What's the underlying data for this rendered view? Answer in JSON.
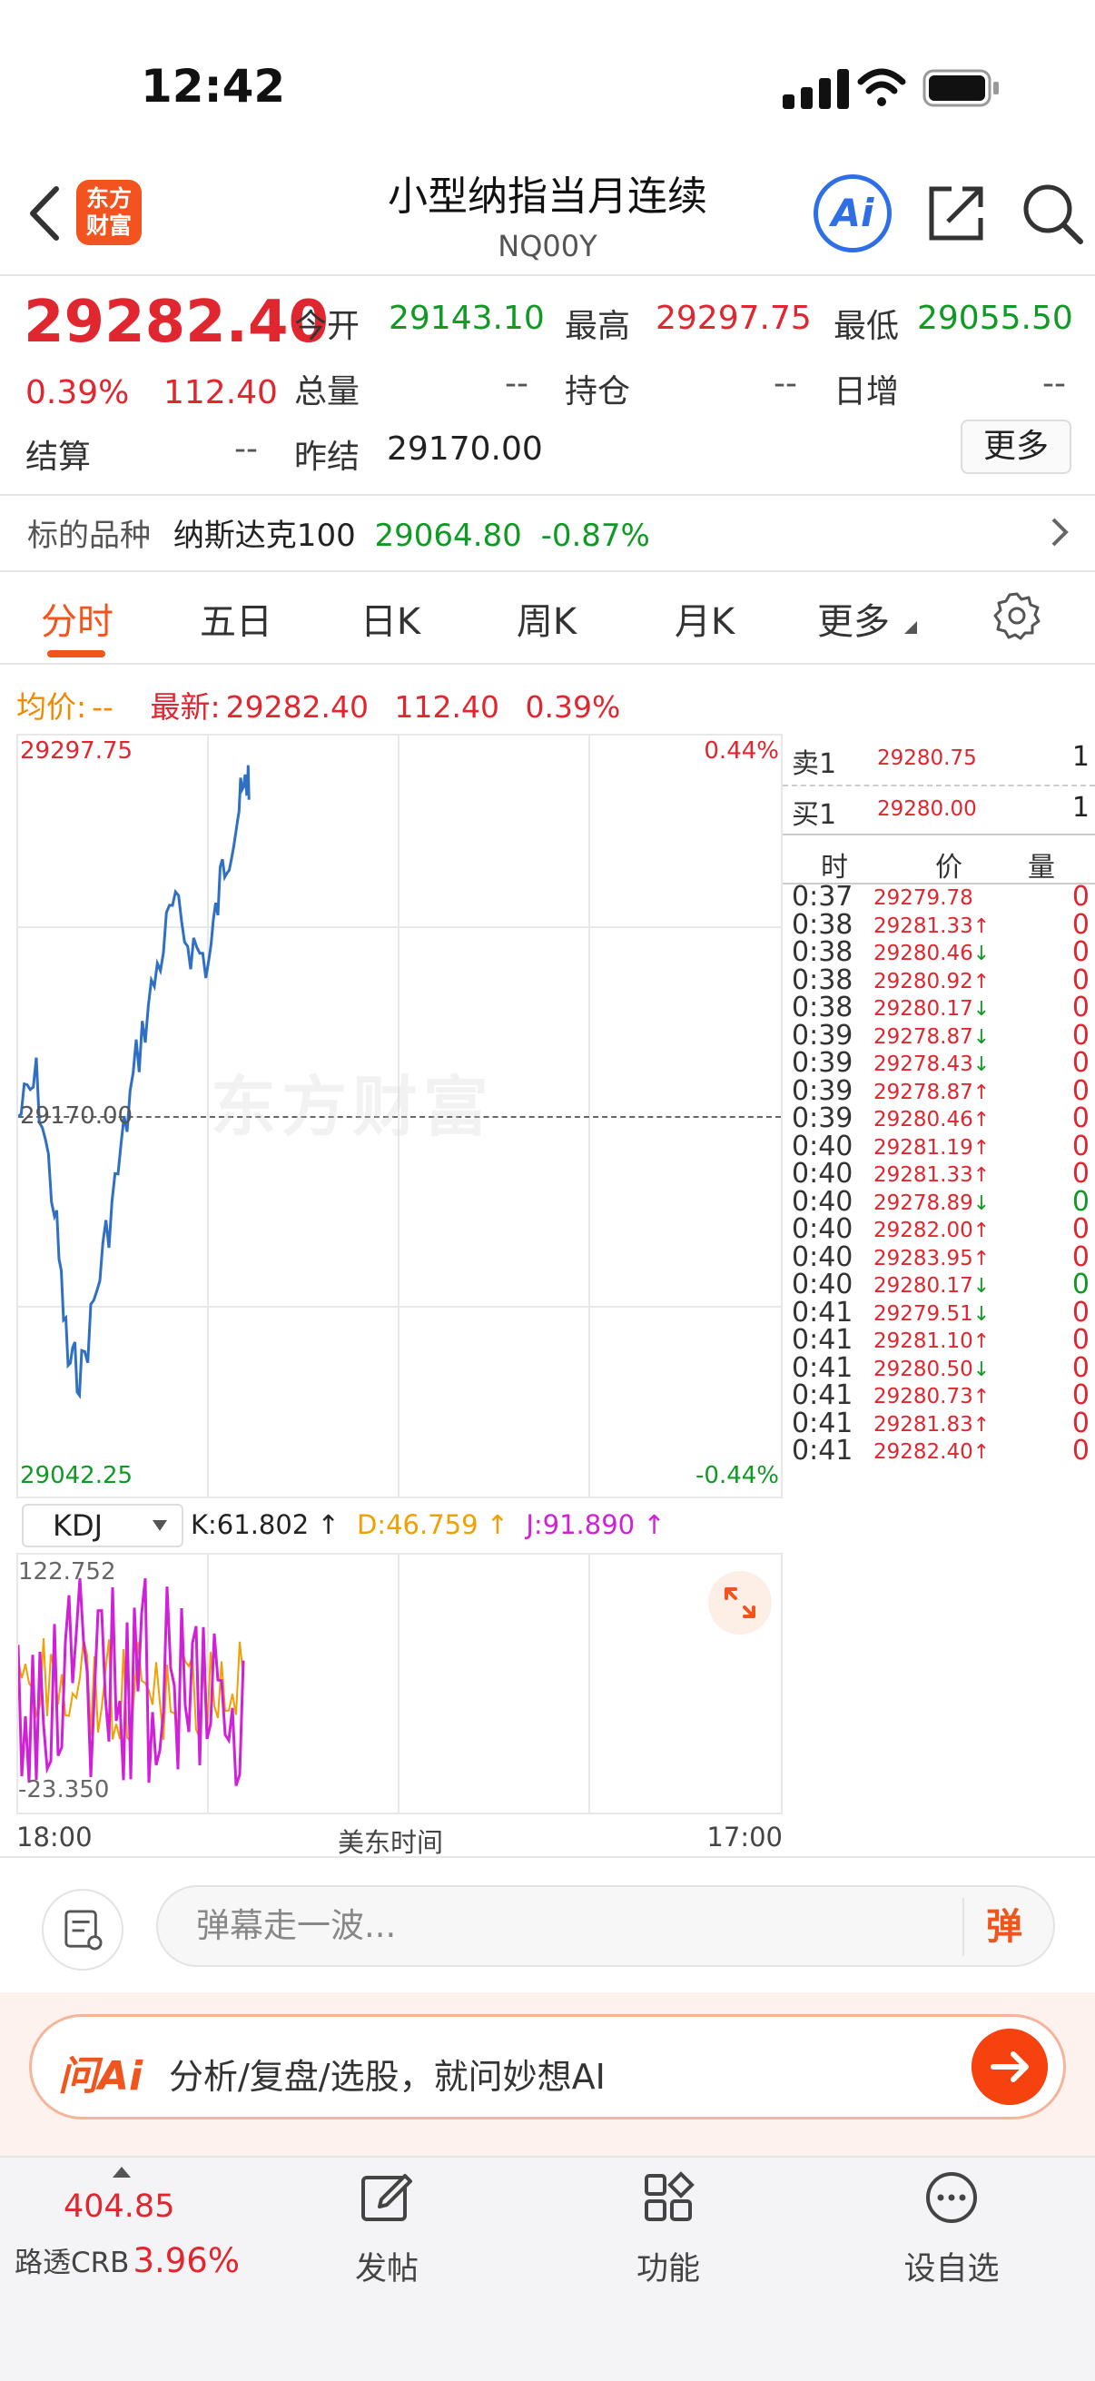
{
  "status": {
    "time": "12:42"
  },
  "header": {
    "logo_line1": "东方",
    "logo_line2": "财富",
    "title": "小型纳指当月连续",
    "code": "NQ00Y",
    "ai_label": "Ai"
  },
  "quote": {
    "price": "29282.40",
    "change_pct": "0.39%",
    "change": "112.40",
    "open_label": "今开",
    "open": "29143.10",
    "high_label": "最高",
    "high": "29297.75",
    "low_label": "最低",
    "low": "29055.50",
    "volume_label": "总量",
    "volume": "--",
    "position_label": "持仓",
    "position": "--",
    "daily_inc_label": "日增",
    "daily_inc": "--",
    "settle_label": "结算",
    "settle": "--",
    "prev_settle_label": "昨结",
    "prev_settle": "29170.00",
    "more_label": "更多"
  },
  "underlying": {
    "label": "标的品种",
    "name": "纳斯达克100",
    "price": "29064.80",
    "change": "-0.87%"
  },
  "tabs": [
    "分时",
    "五日",
    "日K",
    "周K",
    "月K",
    "更多"
  ],
  "avg_row": {
    "avg_label": "均价:",
    "avg_value": "--",
    "latest_label": "最新:",
    "latest_price": "29282.40",
    "latest_change": "112.40",
    "latest_pct": "0.39%"
  },
  "chart_labels": {
    "y_top": "29297.75",
    "y_mid": "29170.00",
    "y_bottom": "29042.25",
    "pct_top": "0.44%",
    "pct_bottom": "-0.44%",
    "watermark": "东方财富"
  },
  "kdj": {
    "indicator": "KDJ",
    "k": "K:61.802 ↑",
    "d": "D:46.759 ↑",
    "j": "J:91.890 ↑",
    "y_top": "122.752",
    "y_bottom": "-23.350",
    "time_start": "18:00",
    "time_mid": "美东时间",
    "time_end": "17:00"
  },
  "order_book": {
    "sell_label": "卖1",
    "sell_price": "29280.75",
    "sell_qty": "1",
    "buy_label": "买1",
    "buy_price": "29280.00",
    "buy_qty": "1",
    "col_time": "时",
    "col_price": "价",
    "col_qty": "量"
  },
  "ticks": [
    {
      "t": "0:37",
      "p": "29279.78",
      "d": "",
      "q": "0",
      "qc": "red"
    },
    {
      "t": "0:38",
      "p": "29281.33",
      "d": "↑",
      "q": "0",
      "qc": "red"
    },
    {
      "t": "0:38",
      "p": "29280.46",
      "d": "↓",
      "q": "0",
      "qc": "red"
    },
    {
      "t": "0:38",
      "p": "29280.92",
      "d": "↑",
      "q": "0",
      "qc": "red"
    },
    {
      "t": "0:38",
      "p": "29280.17",
      "d": "↓",
      "q": "0",
      "qc": "red"
    },
    {
      "t": "0:39",
      "p": "29278.87",
      "d": "↓",
      "q": "0",
      "qc": "red"
    },
    {
      "t": "0:39",
      "p": "29278.43",
      "d": "↓",
      "q": "0",
      "qc": "red"
    },
    {
      "t": "0:39",
      "p": "29278.87",
      "d": "↑",
      "q": "0",
      "qc": "red"
    },
    {
      "t": "0:39",
      "p": "29280.46",
      "d": "↑",
      "q": "0",
      "qc": "red"
    },
    {
      "t": "0:40",
      "p": "29281.19",
      "d": "↑",
      "q": "0",
      "qc": "red"
    },
    {
      "t": "0:40",
      "p": "29281.33",
      "d": "↑",
      "q": "0",
      "qc": "red"
    },
    {
      "t": "0:40",
      "p": "29278.89",
      "d": "↓",
      "q": "0",
      "qc": "green"
    },
    {
      "t": "0:40",
      "p": "29282.00",
      "d": "↑",
      "q": "0",
      "qc": "red"
    },
    {
      "t": "0:40",
      "p": "29283.95",
      "d": "↑",
      "q": "0",
      "qc": "red"
    },
    {
      "t": "0:40",
      "p": "29280.17",
      "d": "↓",
      "q": "0",
      "qc": "green"
    },
    {
      "t": "0:41",
      "p": "29279.51",
      "d": "↓",
      "q": "0",
      "qc": "red"
    },
    {
      "t": "0:41",
      "p": "29281.10",
      "d": "↑",
      "q": "0",
      "qc": "red"
    },
    {
      "t": "0:41",
      "p": "29280.50",
      "d": "↓",
      "q": "0",
      "qc": "red"
    },
    {
      "t": "0:41",
      "p": "29280.73",
      "d": "↑",
      "q": "0",
      "qc": "red"
    },
    {
      "t": "0:41",
      "p": "29281.83",
      "d": "↑",
      "q": "0",
      "qc": "red"
    },
    {
      "t": "0:41",
      "p": "29282.40",
      "d": "↑",
      "q": "0",
      "qc": "red"
    }
  ],
  "comment": {
    "placeholder": "弹幕走一波...",
    "danmu_label": "弹"
  },
  "ai_bar": {
    "logo": "问Ai",
    "text": "分析/复盘/选股，就问妙想AI"
  },
  "nav": {
    "ticker_value": "404.85",
    "ticker_name": "路透CRB",
    "ticker_pct": "3.96%",
    "post": "发帖",
    "func": "功能",
    "watchlist": "设自选"
  },
  "colors": {
    "up": "#e0262e",
    "down": "#109a24",
    "line": "#2f6fc4",
    "accent": "#f0551e",
    "k": "#f0a000",
    "j": "#d020d8"
  }
}
